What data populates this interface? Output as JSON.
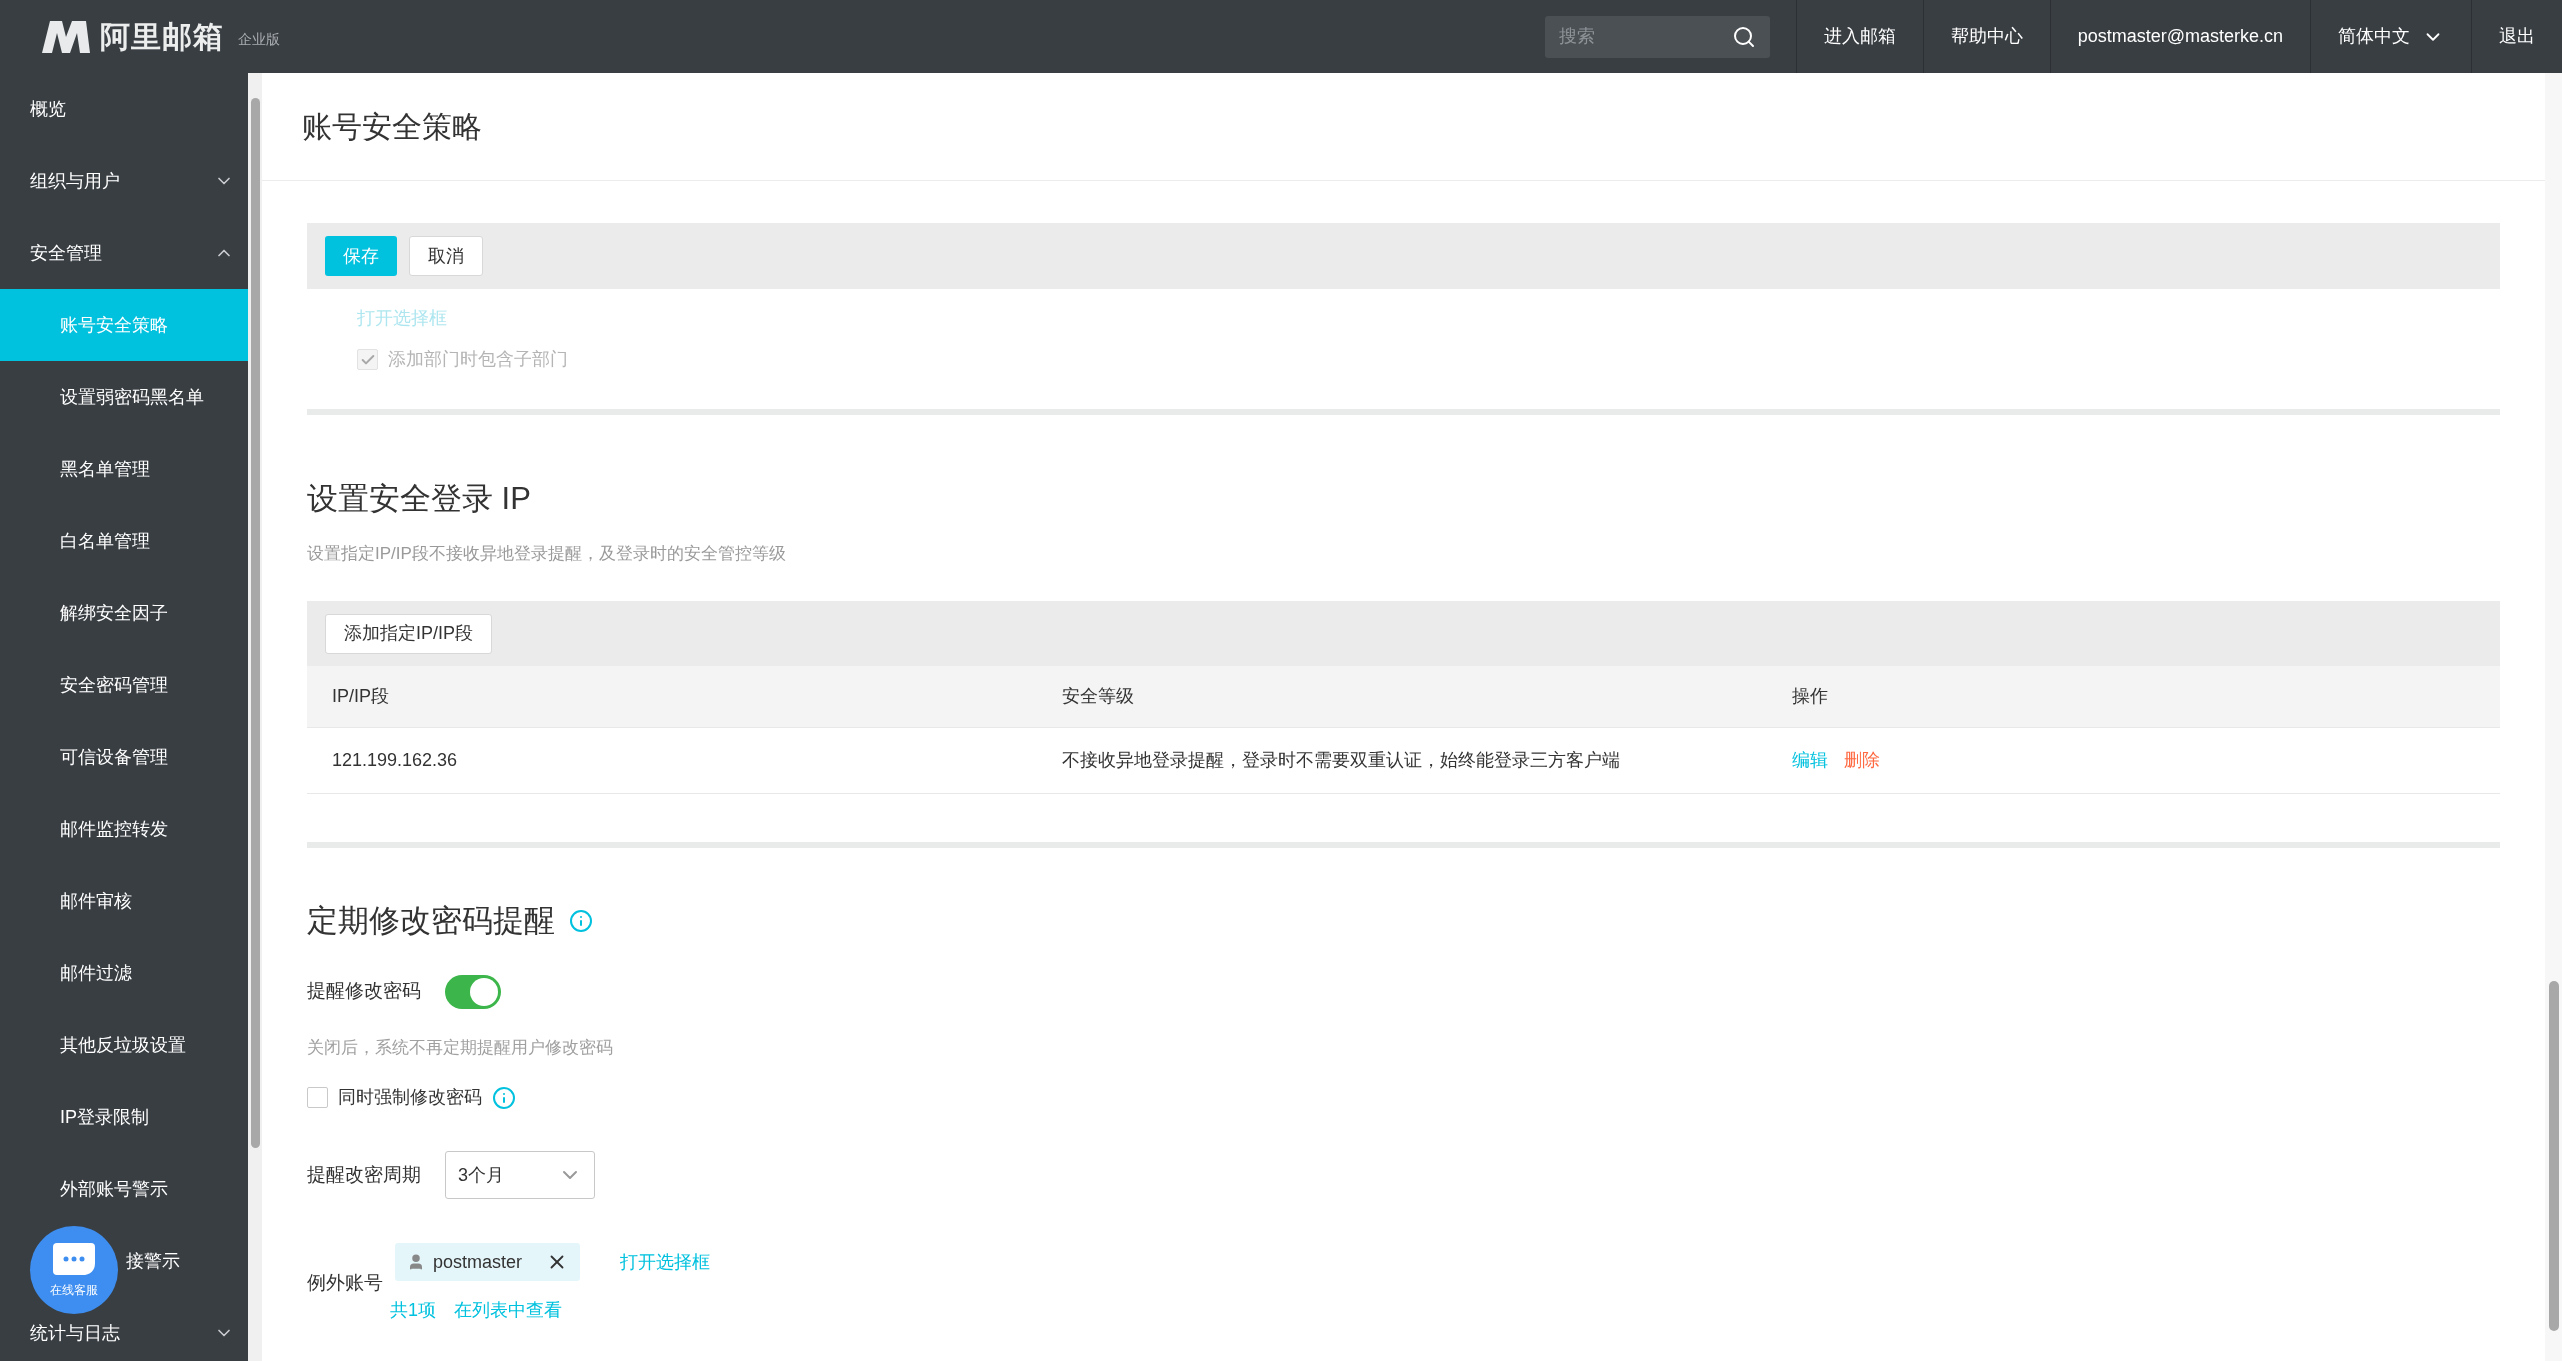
{
  "header": {
    "logo_text": "阿里邮箱",
    "edition": "企业版",
    "search": {
      "placeholder": "搜索"
    },
    "nav": [
      {
        "label": "进入邮箱",
        "kind": "link"
      },
      {
        "label": "帮助中心",
        "kind": "link"
      },
      {
        "label": "postmaster@masterke.cn",
        "kind": "link"
      },
      {
        "label": "简体中文",
        "kind": "dropdown"
      },
      {
        "label": "退出",
        "kind": "link"
      }
    ]
  },
  "sidebar": {
    "items": [
      {
        "label": "概览",
        "kind": "link"
      },
      {
        "label": "组织与用户",
        "kind": "group",
        "expanded": false
      },
      {
        "label": "安全管理",
        "kind": "group",
        "expanded": true,
        "children": [
          {
            "label": "账号安全策略",
            "selected": true
          },
          {
            "label": "设置弱密码黑名单",
            "selected": false
          },
          {
            "label": "黑名单管理",
            "selected": false
          },
          {
            "label": "白名单管理",
            "selected": false
          },
          {
            "label": "解绑安全因子",
            "selected": false
          },
          {
            "label": "安全密码管理",
            "selected": false
          },
          {
            "label": "可信设备管理",
            "selected": false
          },
          {
            "label": "邮件监控转发",
            "selected": false
          },
          {
            "label": "邮件审核",
            "selected": false
          },
          {
            "label": "邮件过滤",
            "selected": false
          },
          {
            "label": "其他反垃圾设置",
            "selected": false
          },
          {
            "label": "IP登录限制",
            "selected": false
          },
          {
            "label": "外部账号警示",
            "selected": false
          },
          {
            "label": "接警示",
            "selected": false,
            "covered": true
          }
        ]
      },
      {
        "label": "统计与日志",
        "kind": "group",
        "expanded": false
      }
    ]
  },
  "chat_bubble": {
    "label": "在线客服"
  },
  "page_title": "账号安全策略",
  "toolbar": [
    {
      "label": "保存",
      "kind": "primary"
    },
    {
      "label": "取消",
      "kind": "default"
    }
  ],
  "selector_link": {
    "label": "打开选择框",
    "disabled": true
  },
  "include_subdept": {
    "label": "添加部门时包含子部门",
    "checked": true,
    "disabled": true
  },
  "ip_section": {
    "title": "设置安全登录 IP",
    "description": "设置指定IP/IP段不接收异地登录提醒，及登录时的安全管控等级",
    "add_button": "添加指定IP/IP段",
    "columns": [
      "IP/IP段",
      "安全等级",
      "操作"
    ],
    "rows": [
      {
        "ip": "121.199.162.36",
        "level": "不接收异地登录提醒，登录时不需要双重认证，始终能登录三方客户端",
        "actions": [
          {
            "label": "编辑",
            "kind": "edit"
          },
          {
            "label": "删除",
            "kind": "delete"
          }
        ]
      }
    ]
  },
  "reminder_section": {
    "title": "定期修改密码提醒",
    "toggle": {
      "label": "提醒修改密码",
      "on": true
    },
    "hint": "关闭后，系统不再定期提醒用户修改密码",
    "force": {
      "label": "同时强制修改密码",
      "checked": false
    },
    "period": {
      "label": "提醒改密周期",
      "value": "3个月"
    },
    "exceptions": {
      "label": "例外账号",
      "tags": [
        {
          "name": "postmaster"
        }
      ],
      "open_link": "打开选择框",
      "count": "共1项",
      "view_link": "在列表中查看"
    }
  }
}
